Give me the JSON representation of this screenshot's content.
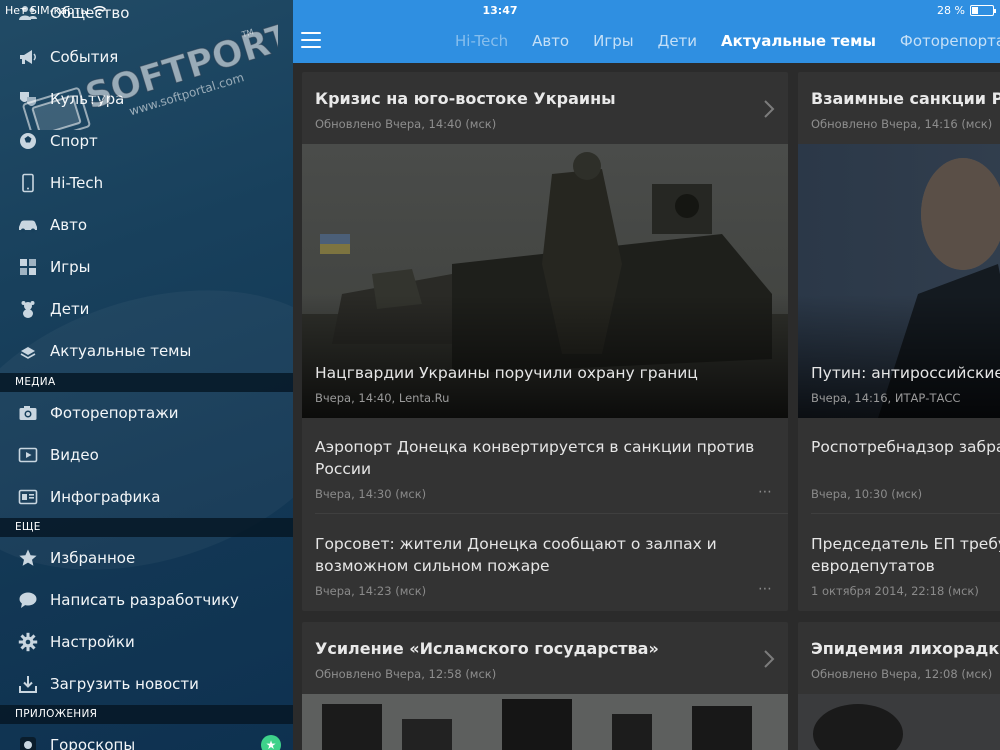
{
  "status": {
    "carrier": "Нет SIM-карты",
    "time": "13:47",
    "battery": "28 %",
    "battery_level": 0.28
  },
  "watermark": {
    "brand": "SOFTPORTAL",
    "trademark": "TM",
    "url": "www.softportal.com"
  },
  "sidebar": {
    "items_top": [
      {
        "label": "Общество",
        "icon": "people-icon"
      },
      {
        "label": "События",
        "icon": "megaphone-icon"
      },
      {
        "label": "Культура",
        "icon": "masks-icon"
      },
      {
        "label": "Спорт",
        "icon": "ball-icon"
      },
      {
        "label": "Hi-Tech",
        "icon": "phone-icon"
      },
      {
        "label": "Авто",
        "icon": "car-icon"
      },
      {
        "label": "Игры",
        "icon": "cubes-icon"
      },
      {
        "label": "Дети",
        "icon": "teddy-bear-icon"
      },
      {
        "label": "Актуальные темы",
        "icon": "stack-icon"
      }
    ],
    "section_media": "МЕДИА",
    "items_media": [
      {
        "label": "Фоторепортажи",
        "icon": "camera-icon"
      },
      {
        "label": "Видео",
        "icon": "video-icon"
      },
      {
        "label": "Инфографика",
        "icon": "infographic-icon"
      }
    ],
    "section_more": "ЕЩЕ",
    "items_more": [
      {
        "label": "Избранное",
        "icon": "star-icon"
      },
      {
        "label": "Написать разработчику",
        "icon": "chat-icon"
      },
      {
        "label": "Настройки",
        "icon": "gear-icon"
      },
      {
        "label": "Загрузить новости",
        "icon": "download-icon"
      }
    ],
    "section_apps": "ПРИЛОЖЕНИЯ",
    "items_apps": [
      {
        "label": "Гороскопы",
        "icon": "horoscope-icon"
      }
    ]
  },
  "tabs": [
    "Hi-Tech",
    "Авто",
    "Игры",
    "Дети",
    "Актуальные темы",
    "Фоторепортажи"
  ],
  "active_tab": "Актуальные темы",
  "cards": {
    "ukraine": {
      "title": "Кризис на юго-востоке Украины",
      "updated": "Обновлено Вчера, 14:40 (мск)",
      "image_caption": "Нацгвардии Украины поручили охрану границ",
      "image_source": "Вчера, 14:40, Lenta.Ru",
      "news": [
        {
          "title": "Аэропорт Донецка конвертируется в санкции против России",
          "meta": "Вчера, 14:30 (мск)"
        },
        {
          "title": "Горсовет: жители Донецка сообщают о залпах и возможном сильном пожаре",
          "meta": "Вчера, 14:23 (мск)"
        }
      ]
    },
    "sanctions": {
      "title": "Взаимные санкции России и Запада",
      "updated": "Обновлено Вчера, 14:16 (мск)",
      "image_caption": "Путин: антироссийские санкции имеют негативные последствия",
      "image_source": "Вчера, 14:16, ИТАР-ТАСС",
      "news": [
        {
          "title": "Роспотребнадзор забраковал партию окорочков",
          "meta": "Вчера, 10:30 (мск)"
        },
        {
          "title": "Председатель ЕП требует сократить список евродепутатов",
          "meta": "1 октября 2014, 22:18 (мск)"
        }
      ]
    },
    "isis": {
      "title": "Усиление «Исламского государства»",
      "updated": "Обновлено Вчера, 12:58 (мск)"
    },
    "epidemic": {
      "title": "Эпидемия лихорадки Эбола",
      "updated": "Обновлено Вчера, 12:08 (мск)"
    }
  },
  "menu_glyph": "⋯",
  "colors": {
    "topbar": "#2f8fe1",
    "sidebar": "#18405c",
    "card": "#333333",
    "badge": "#3ed28a"
  }
}
